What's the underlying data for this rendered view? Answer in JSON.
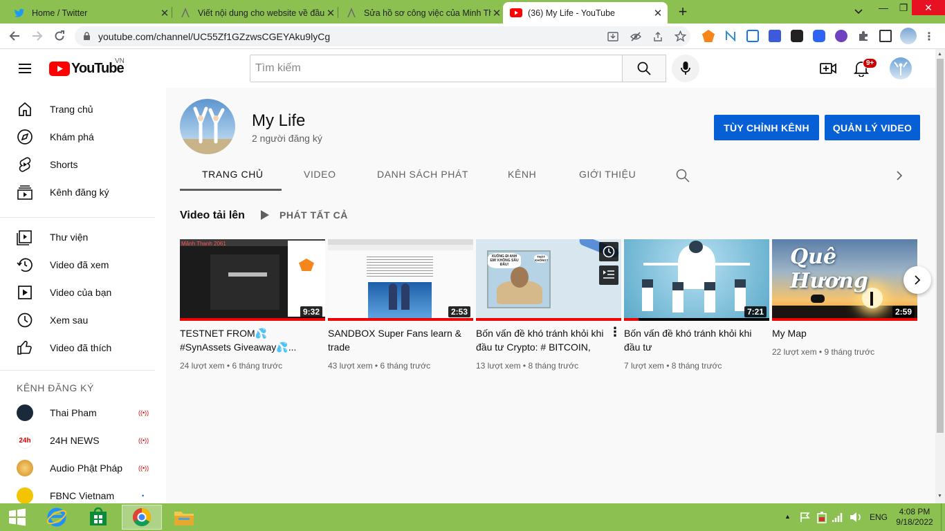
{
  "browser": {
    "tabs": [
      {
        "title": "Home / Twitter",
        "icon": "twitter-icon"
      },
      {
        "title": "Viết nội dung cho website về đầu",
        "icon": "page-icon"
      },
      {
        "title": "Sửa hồ sơ công việc của Minh Th",
        "icon": "page-icon"
      },
      {
        "title": "(36) My Life - YouTube",
        "icon": "youtube-icon"
      }
    ],
    "url": "youtube.com/channel/UC55Zf1GZzwsCGEYAku9lyCg"
  },
  "youtube": {
    "logo_text": "YouTube",
    "region": "VN",
    "search_placeholder": "Tìm kiếm",
    "notif_count": "9+"
  },
  "sidebar": {
    "main": [
      {
        "label": "Trang chủ",
        "icon": "home-icon"
      },
      {
        "label": "Khám phá",
        "icon": "compass-icon"
      },
      {
        "label": "Shorts",
        "icon": "shorts-icon"
      },
      {
        "label": "Kênh đăng ký",
        "icon": "subscriptions-icon"
      }
    ],
    "library": [
      {
        "label": "Thư viện",
        "icon": "library-icon"
      },
      {
        "label": "Video đã xem",
        "icon": "history-icon"
      },
      {
        "label": "Video của bạn",
        "icon": "your-videos-icon"
      },
      {
        "label": "Xem sau",
        "icon": "watch-later-icon"
      },
      {
        "label": "Video đã thích",
        "icon": "like-icon"
      }
    ],
    "subs_heading": "KÊNH ĐĂNG KÝ",
    "subs": [
      {
        "label": "Thai Pham",
        "status": "((•))",
        "color": "#1a2a3a"
      },
      {
        "label": "24H NEWS",
        "status": "((•))",
        "color": "#ffffff"
      },
      {
        "label": "Audio Phật Pháp",
        "status": "((•))",
        "color": "#e0a030"
      },
      {
        "label": "FBNC Vietnam",
        "status": "•",
        "color": "#f5c400"
      }
    ]
  },
  "channel": {
    "name": "My Life",
    "subscribers": "2 người đăng ký",
    "customize_label": "TÙY CHỈNH KÊNH",
    "manage_label": "QUẢN LÝ VIDEO",
    "tabs": [
      "TRANG CHỦ",
      "VIDEO",
      "DANH SÁCH PHÁT",
      "KÊNH",
      "GIỚI THIỆU"
    ],
    "active_tab": "TRANG CHỦ"
  },
  "uploads": {
    "heading": "Video tải lên",
    "play_all": "PHÁT TẤT CẢ",
    "videos": [
      {
        "title": "TESTNET FROM💦 #SynAssets Giveaway💦...",
        "duration": "9:32",
        "views": "24 lượt xem",
        "age": "6 tháng trước",
        "progress": 1.0
      },
      {
        "title": "SANDBOX Super Fans learn & trade",
        "duration": "2:53",
        "views": "43 lượt xem",
        "age": "6 tháng trước",
        "progress": 1.0
      },
      {
        "title": "Bốn vấn đề khó tránh khỏi khi đầu tư Crypto: # BITCOIN, #...",
        "duration": "",
        "views": "13 lượt xem",
        "age": "8 tháng trước",
        "progress": 1.0
      },
      {
        "title": "Bốn vấn đề khó tránh khỏi khi đầu tư",
        "duration": "7:21",
        "views": "7 lượt xem",
        "age": "8 tháng trước",
        "progress": 0.1
      },
      {
        "title": "My Map",
        "duration": "2:59",
        "views": "22 lượt xem",
        "age": "9 tháng trước",
        "progress": 1.0
      }
    ],
    "thumb_text": {
      "v3_bubble": "XUỐNG ĐI ANH EM! KHÔNG SÂU ĐÂU!",
      "v3_bubble2": "THẬT KHÔNG?",
      "v5_title": "Quê Hương"
    }
  },
  "taskbar": {
    "lang": "ENG",
    "time": "4:08 PM",
    "date": "9/18/2022"
  }
}
